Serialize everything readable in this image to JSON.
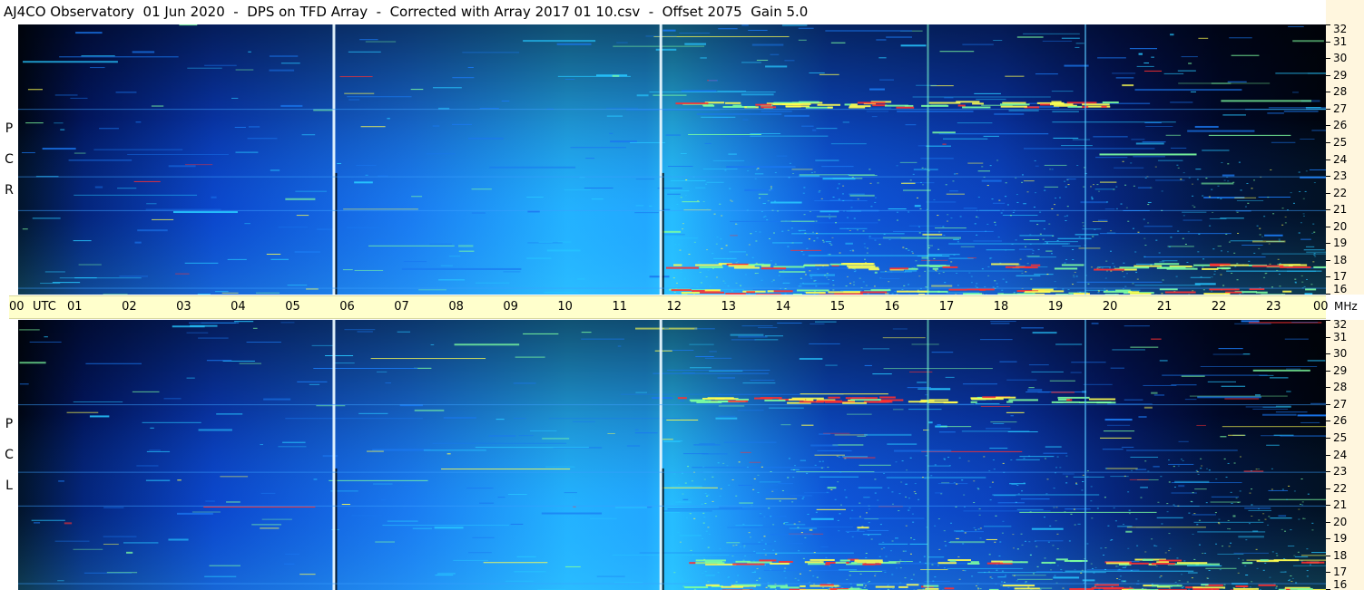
{
  "header": {
    "title": "AJ4CO Observatory  01 Jun 2020  -  DPS on TFD Array  -  Corrected with Array 2017 01 10.csv  -  Offset 2075  Gain 5.0"
  },
  "chart_data": {
    "type": "heatmap",
    "title": "AJ4CO Observatory  01 Jun 2020  -  DPS on TFD Array  -  Corrected with Array 2017 01 10.csv  -  Offset 2075  Gain 5.0",
    "xlabel": "UTC",
    "ylabel_unit": "MHz",
    "x_tick_labels": [
      "00",
      "01",
      "02",
      "03",
      "04",
      "05",
      "06",
      "07",
      "08",
      "09",
      "10",
      "11",
      "12",
      "13",
      "14",
      "15",
      "16",
      "17",
      "18",
      "19",
      "20",
      "21",
      "22",
      "23",
      "00"
    ],
    "xlim": [
      0,
      24
    ],
    "y_ticks": [
      32,
      31,
      30,
      29,
      28,
      27,
      26,
      25,
      24,
      23,
      22,
      21,
      20,
      19,
      18,
      17,
      16
    ],
    "ylim": [
      16,
      32
    ],
    "panels": [
      {
        "name": "RCP",
        "letters": [
          "P",
          "C",
          "R"
        ]
      },
      {
        "name": "LCP",
        "letters": [
          "P",
          "C",
          "L"
        ]
      }
    ],
    "colormap": [
      "#000000",
      "#031a6e",
      "#0b3fcf",
      "#1a78f0",
      "#27c7ff",
      "#7dffa0",
      "#ffff50",
      "#ff3030"
    ],
    "vertical_lines_utc": [
      5.77,
      11.77,
      16.68,
      19.57
    ],
    "bright_bands_mhz": [
      27.3,
      17.7,
      16.2
    ]
  },
  "xaxis": {
    "utc_label": "UTC",
    "unit_label": "MHz"
  }
}
